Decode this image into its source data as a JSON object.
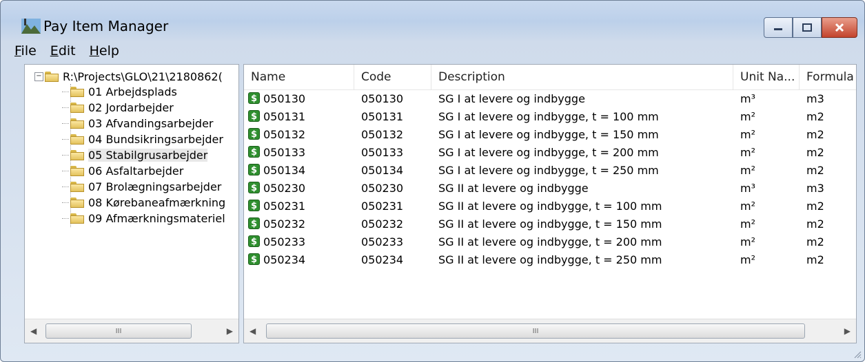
{
  "window": {
    "title": "Pay Item Manager"
  },
  "menu": [
    "File",
    "Edit",
    "Help"
  ],
  "tree": {
    "root": "R:\\Projects\\GLO\\21\\2180862(",
    "children": [
      "01 Arbejdsplads",
      "02 Jordarbejder",
      "03 Afvandingsarbejder",
      "04 Bundsikringsarbejder",
      "05 Stabilgrusarbejder",
      "06 Asfaltarbejder",
      "07 Brolægningsarbejder",
      "08 Kørebaneafmærkning",
      "09 Afmærkningsmateriel"
    ],
    "selected_index": 4
  },
  "columns": [
    "Name",
    "Code",
    "Description",
    "Unit Na...",
    "Formula"
  ],
  "rows": [
    {
      "name": "050130",
      "code": "050130",
      "desc": "SG I at levere og indbygge",
      "unit": "m³",
      "formula": "m3"
    },
    {
      "name": "050131",
      "code": "050131",
      "desc": "SG I at levere og indbygge, t = 100 mm",
      "unit": "m²",
      "formula": "m2"
    },
    {
      "name": "050132",
      "code": "050132",
      "desc": "SG I at levere og indbygge, t = 150 mm",
      "unit": "m²",
      "formula": "m2"
    },
    {
      "name": "050133",
      "code": "050133",
      "desc": "SG I at levere og indbygge, t = 200 mm",
      "unit": "m²",
      "formula": "m2"
    },
    {
      "name": "050134",
      "code": "050134",
      "desc": "SG I at levere og indbygge, t = 250 mm",
      "unit": "m²",
      "formula": "m2"
    },
    {
      "name": "050230",
      "code": "050230",
      "desc": "SG II at levere og indbygge",
      "unit": "m³",
      "formula": "m3"
    },
    {
      "name": "050231",
      "code": "050231",
      "desc": "SG II at levere og indbygge, t = 100 mm",
      "unit": "m²",
      "formula": "m2"
    },
    {
      "name": "050232",
      "code": "050232",
      "desc": "SG II at levere og indbygge, t = 150 mm",
      "unit": "m²",
      "formula": "m2"
    },
    {
      "name": "050233",
      "code": "050233",
      "desc": "SG II at levere og indbygge, t = 200 mm",
      "unit": "m²",
      "formula": "m2"
    },
    {
      "name": "050234",
      "code": "050234",
      "desc": "SG II at levere og indbygge, t = 250 mm",
      "unit": "m²",
      "formula": "m2"
    }
  ],
  "scroll": {
    "left_arrow": "◀",
    "right_arrow": "▶",
    "thumb_grip": "III"
  },
  "icons": {
    "pay_item": "pay-item-dollar-icon",
    "folder": "folder-icon"
  },
  "colors": {
    "pay_icon": "#2f8f2f",
    "close_button": "#c3432c"
  }
}
